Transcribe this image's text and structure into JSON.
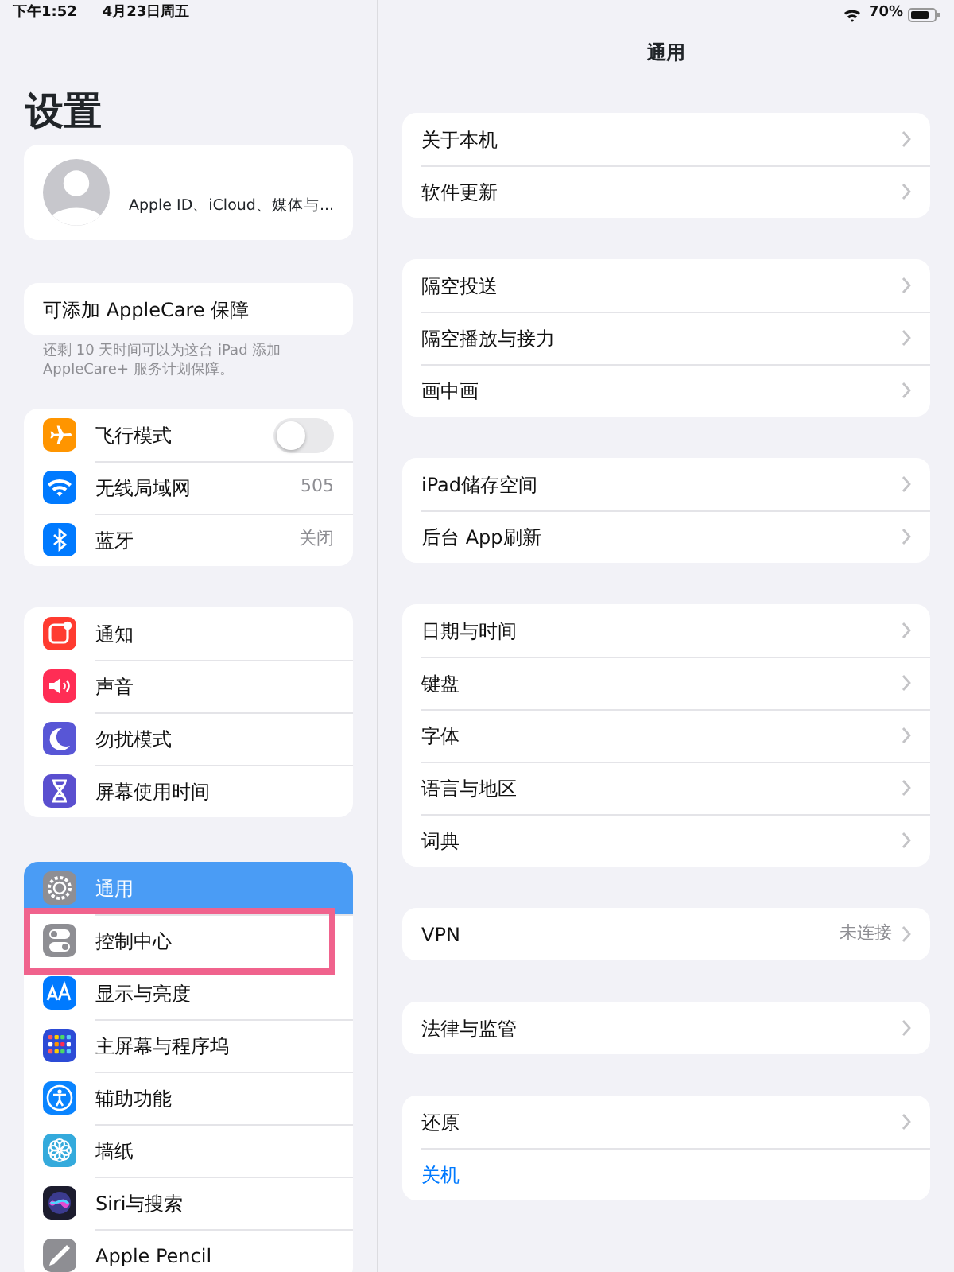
{
  "status_bar": {
    "time": "下午1:52",
    "date": "4月23日周五",
    "battery": "70%"
  },
  "sidebar": {
    "title": "设置",
    "account": {
      "subtitle": "Apple ID、iCloud、媒体与..."
    },
    "applecare": {
      "label": "可添加 AppleCare 保障",
      "note": "还剩 10 天时间可以为这台 iPad 添加 AppleCare+ 服务计划保障。"
    },
    "groups": [
      [
        {
          "label": "飞行模式",
          "color": "#ff9500",
          "kind": "toggle",
          "on": false,
          "selected": false,
          "highlighted": false
        },
        {
          "label": "无线局域网",
          "color": "#007aff",
          "kind": "value",
          "value": "505",
          "selected": false,
          "highlighted": false
        },
        {
          "label": "蓝牙",
          "color": "#007aff",
          "kind": "value",
          "value": "关闭",
          "selected": false,
          "highlighted": false
        }
      ],
      [
        {
          "label": "通知",
          "color": "#ff3b30",
          "kind": "link",
          "selected": false,
          "highlighted": false
        },
        {
          "label": "声音",
          "color": "#ff2d55",
          "kind": "link",
          "selected": false,
          "highlighted": false
        },
        {
          "label": "勿扰模式",
          "color": "#5856d6",
          "kind": "link",
          "selected": false,
          "highlighted": false
        },
        {
          "label": "屏幕使用时间",
          "color": "#5a4fcf",
          "kind": "link",
          "selected": false,
          "highlighted": false
        }
      ],
      [
        {
          "label": "通用",
          "color": "#8e8e93",
          "kind": "link",
          "selected": true,
          "highlighted": false
        },
        {
          "label": "控制中心",
          "color": "#8e8e93",
          "kind": "link",
          "selected": false,
          "highlighted": true
        },
        {
          "label": "显示与亮度",
          "color": "#007aff",
          "kind": "link",
          "selected": false,
          "highlighted": false
        },
        {
          "label": "主屏幕与程序坞",
          "color": "#2c4bd6",
          "kind": "link",
          "selected": false,
          "highlighted": false
        },
        {
          "label": "辅助功能",
          "color": "#0a84ff",
          "kind": "link",
          "selected": false,
          "highlighted": false
        },
        {
          "label": "墙纸",
          "color": "#34aadc",
          "kind": "link",
          "selected": false,
          "highlighted": false
        },
        {
          "label": "Siri与搜索",
          "color": "#1c1c2e",
          "kind": "link",
          "selected": false,
          "highlighted": false
        },
        {
          "label": "Apple Pencil",
          "color": "#8e8e93",
          "kind": "link",
          "selected": false,
          "highlighted": false
        }
      ]
    ]
  },
  "detail": {
    "title": "通用",
    "groups": [
      [
        {
          "label": "关于本机",
          "kind": "link"
        },
        {
          "label": "软件更新",
          "kind": "link"
        }
      ],
      [
        {
          "label": "隔空投送",
          "kind": "link"
        },
        {
          "label": "隔空播放与接力",
          "kind": "link"
        },
        {
          "label": "画中画",
          "kind": "link"
        }
      ],
      [
        {
          "label": "iPad储存空间",
          "kind": "link"
        },
        {
          "label": "后台 App刷新",
          "kind": "link"
        }
      ],
      [
        {
          "label": "日期与时间",
          "kind": "link"
        },
        {
          "label": "键盘",
          "kind": "link"
        },
        {
          "label": "字体",
          "kind": "link"
        },
        {
          "label": "语言与地区",
          "kind": "link"
        },
        {
          "label": "词典",
          "kind": "link"
        }
      ],
      [
        {
          "label": "VPN",
          "kind": "link",
          "value": "未连接"
        }
      ],
      [
        {
          "label": "法律与监管",
          "kind": "link"
        }
      ],
      [
        {
          "label": "还原",
          "kind": "link"
        },
        {
          "label": "关机",
          "kind": "action"
        }
      ]
    ]
  }
}
